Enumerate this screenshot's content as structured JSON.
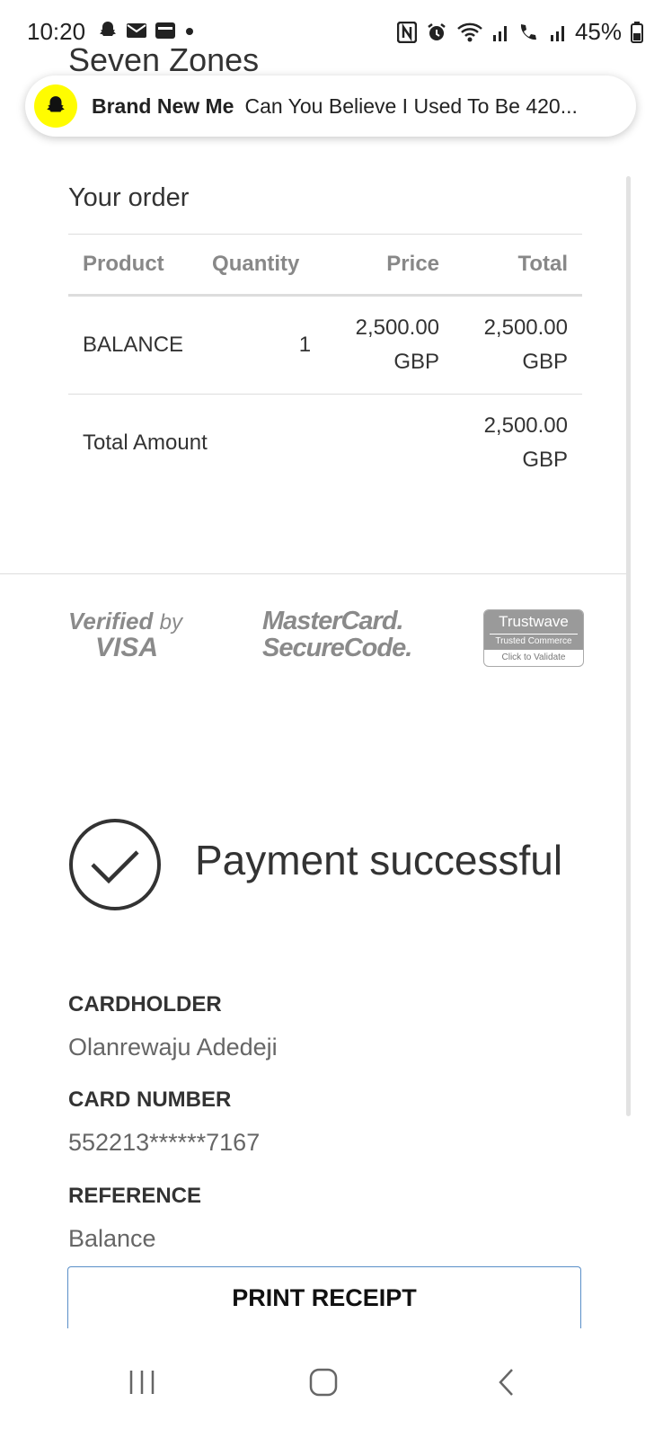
{
  "status_bar": {
    "time": "10:20",
    "notification_icons": [
      "snapchat-icon",
      "mail-icon",
      "wallet-icon",
      "dot-icon"
    ],
    "system_icons": [
      "nfc-icon",
      "alarm-icon",
      "wifi-icon",
      "signal-icon",
      "call-signal-icon",
      "signal-icon"
    ],
    "battery": "45%"
  },
  "site_title": "Seven Zones",
  "notification": {
    "app": "snapchat",
    "title": "Brand New Me",
    "text": "Can You Believe I Used To Be 420..."
  },
  "order": {
    "heading": "Your order",
    "columns": [
      "Product",
      "Quantity",
      "Price",
      "Total"
    ],
    "rows": [
      {
        "product": "BALANCE",
        "quantity": "1",
        "price": "2,500.00 GBP",
        "total": "2,500.00 GBP"
      }
    ],
    "total_label": "Total Amount",
    "total_value": "2,500.00 GBP"
  },
  "security_logos": {
    "visa_line1": "Verified",
    "visa_by": "by",
    "visa_line2": "VISA",
    "mastercard_line1": "MasterCard.",
    "mastercard_line2": "SecureCode.",
    "trustwave_name": "Trustwave",
    "trustwave_sub": "Trusted Commerce",
    "trustwave_action": "Click to Validate"
  },
  "payment": {
    "status": "Payment successful",
    "cardholder_label": "CARDHOLDER",
    "cardholder_value": "Olanrewaju Adedeji",
    "card_number_label": "CARD NUMBER",
    "card_number_value": "552213******7167",
    "reference_label": "REFERENCE",
    "reference_value": "Balance"
  },
  "print_button": "PRINT RECEIPT",
  "nav_bar": [
    "recents-icon",
    "home-icon",
    "back-icon"
  ],
  "colors": {
    "snapchat_yellow": "#fffc00",
    "button_border": "#5a8fc8",
    "logo_gray": "#8a8a8a"
  }
}
